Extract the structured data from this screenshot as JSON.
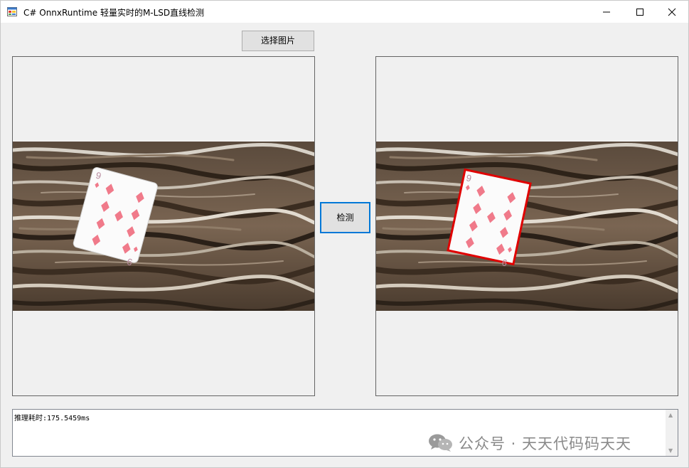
{
  "window": {
    "title": "C# OnnxRuntime 轻量实时的M-LSD直线检测"
  },
  "toolbar": {
    "select_image_label": "选择图片",
    "detect_label": "检测"
  },
  "output": {
    "text": "推理耗时:175.5459ms"
  },
  "card": {
    "rank_top": "9",
    "rank_bottom": "9",
    "suit_icon": "diamond-icon"
  },
  "watermark": {
    "text": "公众号 · 天天代码码天天"
  },
  "colors": {
    "detected_line": "#e00000",
    "diamond": "#f07a8a",
    "focus_border": "#0078d7"
  }
}
